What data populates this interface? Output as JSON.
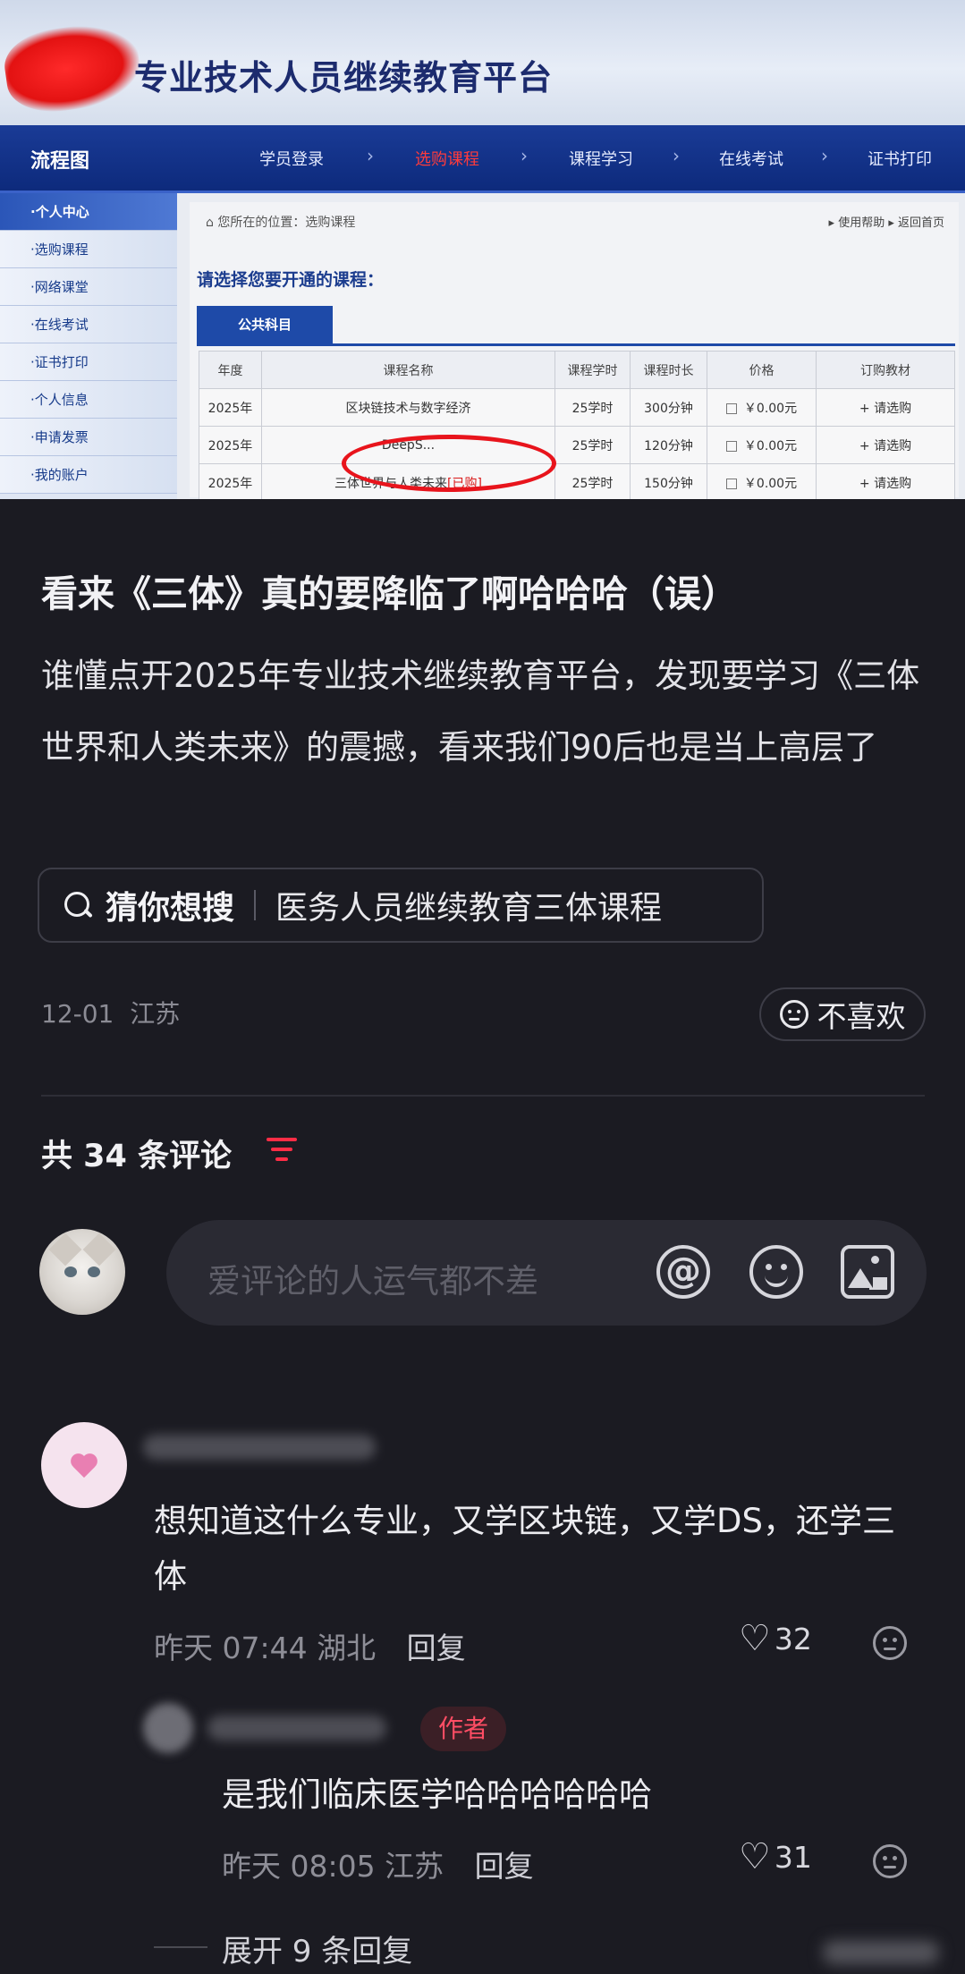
{
  "photo": {
    "site_title": "专业技术人员继续教育平台",
    "nav": {
      "flow_label": "流程图",
      "steps": [
        "学员登录",
        "选购课程",
        "课程学习",
        "在线考试",
        "证书打印"
      ]
    },
    "sidebar": [
      "·个人中心",
      "·选购课程",
      "·网络课堂",
      "·在线考试",
      "·证书打印",
      "·个人信息",
      "·申请发票",
      "·我的账户"
    ],
    "breadcrumb": "您所在的位置：选购课程",
    "breadcrumb_right": "▸ 使用帮助  ▸ 返回首页",
    "choose_heading": "请选择您要开通的课程：",
    "tab": "公共科目",
    "table": {
      "headers": [
        "年度",
        "课程名称",
        "课程学时",
        "课程时长",
        "价格",
        "订购教材"
      ],
      "rows": [
        {
          "year": "2025年",
          "name": "区块链技术与数字经济",
          "hours": "25学时",
          "duration": "300分钟",
          "price": "￥0.00元",
          "action": "+ 请选购"
        },
        {
          "year": "2025年",
          "name": "DeepS...",
          "hours": "25学时",
          "duration": "120分钟",
          "price": "￥0.00元",
          "action": "+ 请选购"
        },
        {
          "year": "2025年",
          "name": "三体世界与人类未来",
          "bought": "[已购]",
          "hours": "25学时",
          "duration": "150分钟",
          "price": "￥0.00元",
          "action": "+ 请选购"
        }
      ]
    }
  },
  "post": {
    "title": "看来《三体》真的要降临了啊哈哈哈（误）",
    "body": "谁懂点开2025年专业技术继续教育平台，发现要学习《三体世界和人类未来》的震撼，看来我们90后也是当上高层了",
    "guess_label": "猜你想搜",
    "guess_query": "医务人员继续教育三体课程",
    "date": "12-01",
    "location": "江苏",
    "dislike": "不喜欢"
  },
  "comments_header": {
    "count_text": "共 34 条评论"
  },
  "comment_input": {
    "placeholder": "爱评论的人运气都不差"
  },
  "comments": [
    {
      "text": "想知道这什么专业，又学区块链，又学DS，还学三体",
      "time": "昨天 07:44",
      "location": "湖北",
      "reply": "回复",
      "likes": "32"
    },
    {
      "badge": "作者",
      "text": "是我们临床医学哈哈哈哈哈哈",
      "time": "昨天 08:05",
      "location": "江苏",
      "reply": "回复",
      "likes": "31"
    }
  ],
  "expand_replies": "展开 9 条回复",
  "icons": [
    "search-icon",
    "dislike-face-icon",
    "sort-icon",
    "at-icon",
    "emoji-icon",
    "image-icon",
    "heart-icon"
  ],
  "colors": {
    "background": "#1b1b22",
    "accent": "#ff2d46",
    "photo_nav": "#0d2a7c"
  }
}
